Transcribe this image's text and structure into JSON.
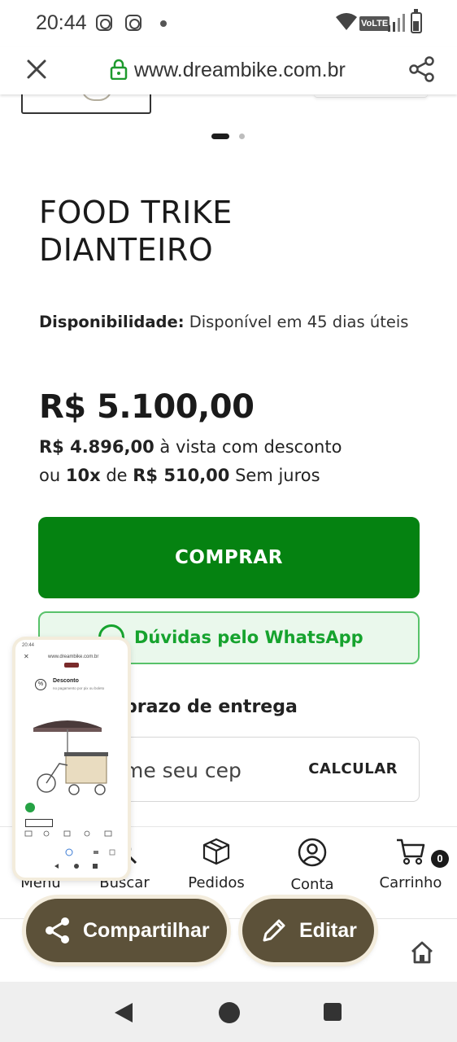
{
  "status_bar": {
    "time": "20:44",
    "network": "VoLTE"
  },
  "url_bar": {
    "url": "www.dreambike.com.br"
  },
  "product": {
    "title": "FOOD TRIKE DIANTEIRO",
    "availability_label": "Disponibilidade:",
    "availability_value": "Disponível em 45 dias úteis",
    "price": "R$ 5.100,00",
    "cash_price": "R$ 4.896,00",
    "cash_text": "à vista com desconto",
    "installments_prefix": "ou",
    "installments_count": "10x",
    "installments_mid": "de",
    "installment_value": "R$ 510,00",
    "installments_suffix": "Sem juros"
  },
  "buttons": {
    "buy": "COMPRAR",
    "whatsapp": "Dúvidas pelo WhatsApp"
  },
  "shipping": {
    "title_visible": "prazo de entrega",
    "placeholder": "me seu cep",
    "calculate": "CALCULAR"
  },
  "bottom_nav": {
    "items": [
      {
        "label": "Menu",
        "icon": "menu-icon"
      },
      {
        "label": "Buscar",
        "icon": "search-icon"
      },
      {
        "label": "Pedidos",
        "icon": "box-icon"
      },
      {
        "label": "Conta",
        "icon": "user-icon"
      },
      {
        "label": "Carrinho",
        "icon": "cart-icon"
      }
    ],
    "cart_count": "0"
  },
  "screenshot_actions": {
    "share": "Compartilhar",
    "edit": "Editar"
  },
  "preview": {
    "url": "www.dreambike.com.br",
    "discount_title": "Desconto",
    "discount_sub": "no pagamento por pix ou boleto"
  },
  "colors": {
    "buy_green": "#058211",
    "whatsapp_green": "#16a32e",
    "pill_brown": "#5c5139"
  }
}
